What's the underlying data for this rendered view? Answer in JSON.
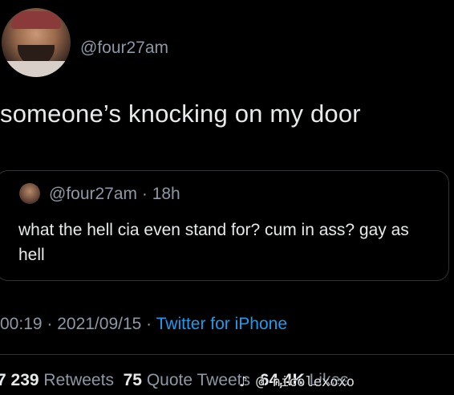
{
  "tweet": {
    "handle": "@four27am",
    "text": "someone’s knocking on my door",
    "timestamp": "00:19 · 2021/09/15 · ",
    "source": "Twitter for iPhone"
  },
  "quoted_tweet": {
    "handle": "@four27am · 18h",
    "text": "what the hell cia even stand for? cum in ass? gay as hell"
  },
  "stats": {
    "retweets_count": "7 239",
    "retweets_label": "Retweets",
    "quotes_count": "75",
    "quotes_label": "Quote Tweets",
    "likes_count": "64,4K",
    "likes_label": "Likes"
  },
  "watermark": {
    "icon": "tiktok-icon",
    "text": "@ nicolexoxo"
  },
  "colors": {
    "background": "#000000",
    "text": "#e7e9ea",
    "secondary": "#8b98a5",
    "link": "#1d9bf0",
    "border": "#2f3336"
  }
}
